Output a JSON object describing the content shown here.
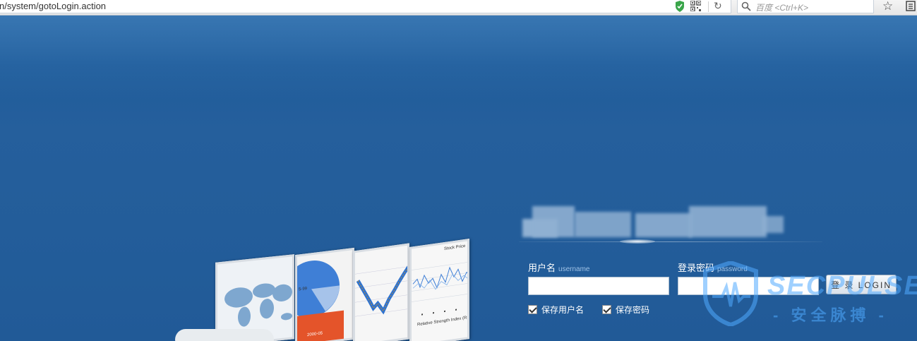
{
  "browser": {
    "url": "n/system/gotoLogin.action",
    "search_placeholder": "百度 <Ctrl+K>"
  },
  "login": {
    "username_label": "用户名",
    "username_sub": "username",
    "password_label": "登录密码",
    "password_sub": "password",
    "username_value": "",
    "password_value": "",
    "login_button": "登 录 LOGIN",
    "save_username": "保存用户名",
    "save_password": "保存密码",
    "save_username_checked": true,
    "save_password_checked": true
  },
  "cards": {
    "card2_label_top": "5-99",
    "card2_label_bottom": "2000-05",
    "card4_title": "Stock Price",
    "card4_footer": "Relative Strength Index (RSI)"
  },
  "watermark": {
    "main": "SECPULSE",
    "sub": "- 安全脉搏 -"
  },
  "colors": {
    "page_bg": "#215a97",
    "accent": "#2b6aa6",
    "watermark": "#50aaff"
  }
}
